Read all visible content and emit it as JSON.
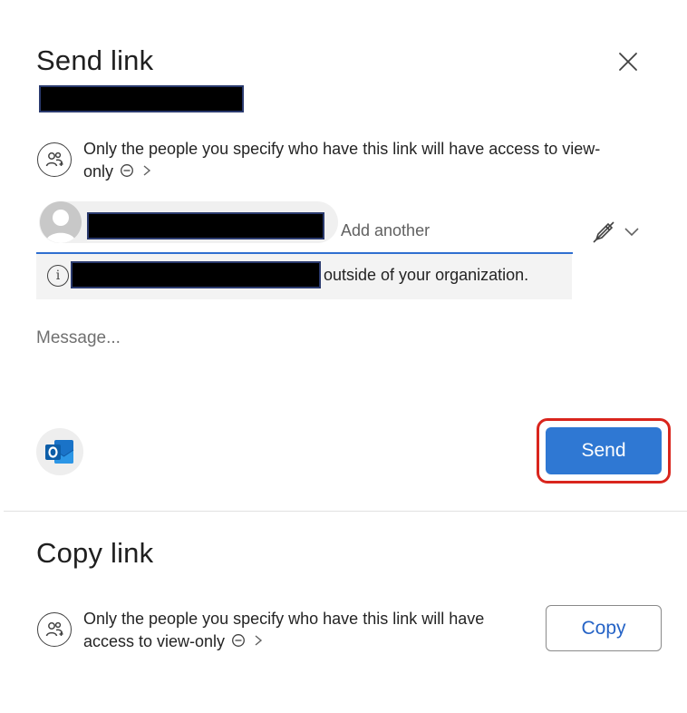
{
  "send_link": {
    "title": "Send link",
    "access_line1": "Only the people you specify who have this link will have access to view-",
    "access_line2": "only",
    "add_another_placeholder": "Add another",
    "notice_text": "outside of your organization.",
    "message_placeholder": "Message...",
    "send_label": "Send"
  },
  "copy_link": {
    "title": "Copy link",
    "access_line1": "Only the people you specify who have this link will have",
    "access_line2": "access to view-only",
    "copy_label": "Copy"
  },
  "colors": {
    "primary": "#2f78d3",
    "highlight": "#d9251d",
    "input_underline": "#2f6fd0"
  },
  "icons": [
    "close-icon",
    "people-icon",
    "eye-off-icon",
    "chevron-right-icon",
    "avatar-icon",
    "edit-pencil-icon",
    "chevron-down-icon",
    "info-icon",
    "outlook-icon"
  ]
}
